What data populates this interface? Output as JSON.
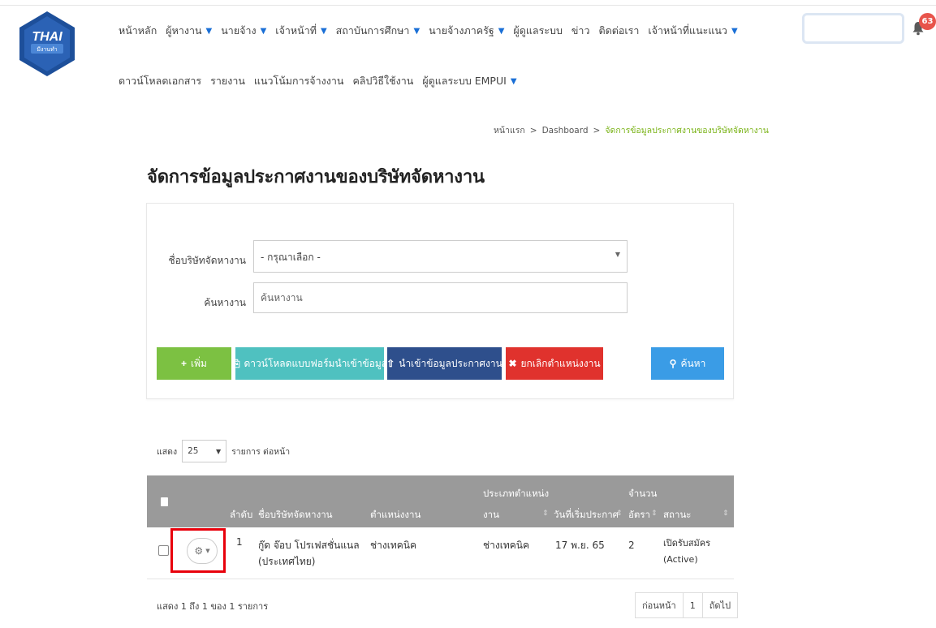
{
  "brand": {
    "logo_text": "THAI",
    "logo_subtext": "มีงานทำ"
  },
  "nav": {
    "row1": [
      {
        "label": "หน้าหลัก",
        "caret": false
      },
      {
        "label": "ผู้หางาน",
        "caret": true
      },
      {
        "label": "นายจ้าง",
        "caret": true
      },
      {
        "label": "เจ้าหน้าที่",
        "caret": true
      },
      {
        "label": "สถาบันการศึกษา",
        "caret": true
      },
      {
        "label": "นายจ้างภาครัฐ",
        "caret": true
      },
      {
        "label": "ผู้ดูแลระบบ",
        "caret": false
      },
      {
        "label": "ข่าว",
        "caret": false
      },
      {
        "label": "ติดต่อเรา",
        "caret": false
      },
      {
        "label": "เจ้าหน้าที่แนะแนว",
        "caret": true
      }
    ],
    "row2": [
      {
        "label": "ดาวน์โหลดเอกสาร",
        "caret": false
      },
      {
        "label": "รายงาน",
        "caret": false
      },
      {
        "label": "แนวโน้มการจ้างงาน",
        "caret": false
      },
      {
        "label": "คลิปวิธีใช้งาน",
        "caret": false
      },
      {
        "label": "ผู้ดูแลระบบ EMPUI",
        "caret": true
      }
    ],
    "caret_symbol": "▼"
  },
  "notifications": {
    "count": "63"
  },
  "breadcrumb": {
    "home": "หน้าแรก",
    "sep": ">",
    "dashboard": "Dashboard",
    "current": "จัดการข้อมูลประกาศงานของบริษัทจัดหางาน"
  },
  "page_title": "จัดการข้อมูลประกาศงานของบริษัทจัดหางาน",
  "filter": {
    "company_label": "ชื่อบริษัทจัดหางาน",
    "company_value": "- กรุณาเลือก -",
    "search_label": "ค้นหางาน",
    "search_placeholder": "ค้นหางาน"
  },
  "buttons": {
    "add": {
      "icon": "+",
      "label": "เพิ่ม"
    },
    "download_template": {
      "icon": "⎘",
      "label": "ดาวน์โหลดแบบฟอร์มนำเข้าข้อมูล"
    },
    "import": {
      "icon": "⇧",
      "label": "นำเข้าข้อมูลประกาศงาน"
    },
    "cancel_position": {
      "icon": "✖",
      "label": "ยกเลิกตำแหน่งงาน"
    },
    "search": {
      "icon": "⚲",
      "label": "ค้นหา"
    }
  },
  "page_size": {
    "prefix": "แสดง",
    "value": "25",
    "suffix": "รายการ ต่อหน้า"
  },
  "table": {
    "headers": {
      "order": "ลำดับ",
      "company": "ชื่อบริษัทจัดหางาน",
      "position": "ตำแหน่งงาน",
      "type_line1": "ประเภทตำแหน่ง",
      "type_line2": "งาน",
      "start_date": "วันที่เริ่มประกาศ",
      "count_line1": "จำนวน",
      "count_line2": "อัตรา",
      "status": "สถานะ"
    },
    "rows": [
      {
        "order": "1",
        "company_line1": "กู๊ด จ๊อบ โปรเฟสชั่นแนล",
        "company_line2": "(ประเทศไทย)",
        "position": "ช่างเทคนิค",
        "type": "ช่างเทคนิค",
        "start_date": "17 พ.ย. 65",
        "count": "2",
        "status_line1": "เปิดรับสมัคร",
        "status_line2": "(Active)"
      }
    ]
  },
  "footer": {
    "info": "แสดง 1 ถึง 1 ของ 1 รายการ",
    "prev": "ก่อนหน้า",
    "page": "1",
    "next": "ถัดไป"
  },
  "colors": {
    "add": "#7cc142",
    "download": "#4fc1c0",
    "import": "#2e4f8c",
    "cancel": "#e0322d",
    "search": "#3a9ce6",
    "table_header": "#9a9a9a",
    "highlight": "#e8000b",
    "breadcrumb_current": "#7ab317"
  }
}
